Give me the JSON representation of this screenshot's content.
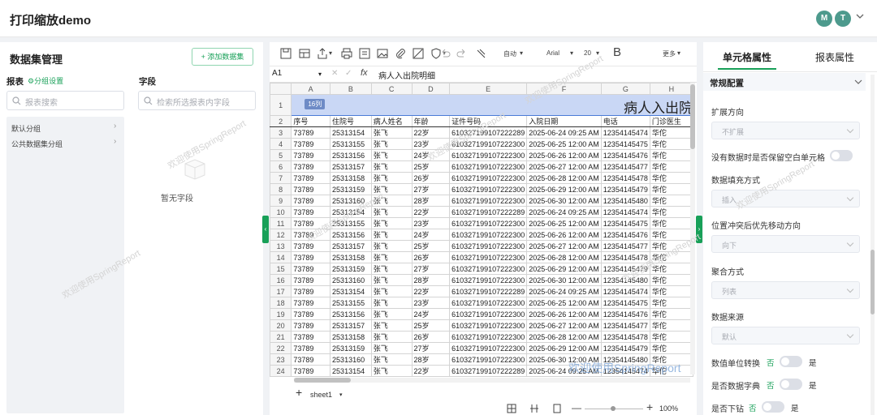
{
  "app": {
    "title": "打印缩放demo",
    "avatars": [
      "M",
      "T"
    ]
  },
  "left": {
    "title": "数据集管理",
    "add_button": "+ 添加数据集",
    "table_label": "报表",
    "group_settings": "分组设置",
    "table_search_placeholder": "报表搜索",
    "field_label": "字段",
    "field_search_placeholder": "检索所选报表内字段",
    "groups": [
      "默认分组",
      "公共数据集分组"
    ],
    "empty_text": "暂无字段"
  },
  "toolbar": {
    "auto": "自动",
    "font": "Arial",
    "font_size": "20",
    "more": "更多"
  },
  "formula": {
    "cell": "A1",
    "fx": "fx",
    "value": "病人入出院明细"
  },
  "sheet": {
    "columns": [
      "A",
      "B",
      "C",
      "D",
      "E",
      "F",
      "G",
      "H"
    ],
    "title_badge": "16列",
    "title_text": "病人入出院",
    "headers": [
      "序号",
      "住院号",
      "病人姓名",
      "年龄",
      "证件号码",
      "入院日期",
      "电话",
      "门诊医生"
    ],
    "rows": [
      [
        "3",
        "73789",
        "25313154",
        "张飞",
        "22岁",
        "610327199107222289",
        "2025-06-24 09:25 AM",
        "12354145474",
        "华佗"
      ],
      [
        "4",
        "73789",
        "25313155",
        "张飞",
        "23岁",
        "610327199107222300",
        "2025-06-25 12:00 AM",
        "12354145475",
        "华佗"
      ],
      [
        "5",
        "73789",
        "25313156",
        "张飞",
        "24岁",
        "610327199107222300",
        "2025-06-26 12:00 AM",
        "12354145476",
        "华佗"
      ],
      [
        "6",
        "73789",
        "25313157",
        "张飞",
        "25岁",
        "610327199107222300",
        "2025-06-27 12:00 AM",
        "12354145477",
        "华佗"
      ],
      [
        "7",
        "73789",
        "25313158",
        "张飞",
        "26岁",
        "610327199107222300",
        "2025-06-28 12:00 AM",
        "12354145478",
        "华佗"
      ],
      [
        "8",
        "73789",
        "25313159",
        "张飞",
        "27岁",
        "610327199107222300",
        "2025-06-29 12:00 AM",
        "12354145479",
        "华佗"
      ],
      [
        "9",
        "73789",
        "25313160",
        "张飞",
        "28岁",
        "610327199107222300",
        "2025-06-30 12:00 AM",
        "12354145480",
        "华佗"
      ],
      [
        "10",
        "73789",
        "25313154",
        "张飞",
        "22岁",
        "610327199107222289",
        "2025-06-24 09:25 AM",
        "12354145474",
        "华佗"
      ],
      [
        "11",
        "73789",
        "25313155",
        "张飞",
        "23岁",
        "610327199107222300",
        "2025-06-25 12:00 AM",
        "12354145475",
        "华佗"
      ],
      [
        "12",
        "73789",
        "25313156",
        "张飞",
        "24岁",
        "610327199107222300",
        "2025-06-26 12:00 AM",
        "12354145476",
        "华佗"
      ],
      [
        "13",
        "73789",
        "25313157",
        "张飞",
        "25岁",
        "610327199107222300",
        "2025-06-27 12:00 AM",
        "12354145477",
        "华佗"
      ],
      [
        "14",
        "73789",
        "25313158",
        "张飞",
        "26岁",
        "610327199107222300",
        "2025-06-28 12:00 AM",
        "12354145478",
        "华佗"
      ],
      [
        "15",
        "73789",
        "25313159",
        "张飞",
        "27岁",
        "610327199107222300",
        "2025-06-29 12:00 AM",
        "12354145479",
        "华佗"
      ],
      [
        "16",
        "73789",
        "25313160",
        "张飞",
        "28岁",
        "610327199107222300",
        "2025-06-30 12:00 AM",
        "12354145480",
        "华佗"
      ],
      [
        "17",
        "73789",
        "25313154",
        "张飞",
        "22岁",
        "610327199107222289",
        "2025-06-24 09:25 AM",
        "12354145474",
        "华佗"
      ],
      [
        "18",
        "73789",
        "25313155",
        "张飞",
        "23岁",
        "610327199107222300",
        "2025-06-25 12:00 AM",
        "12354145475",
        "华佗"
      ],
      [
        "19",
        "73789",
        "25313156",
        "张飞",
        "24岁",
        "610327199107222300",
        "2025-06-26 12:00 AM",
        "12354145476",
        "华佗"
      ],
      [
        "20",
        "73789",
        "25313157",
        "张飞",
        "25岁",
        "610327199107222300",
        "2025-06-27 12:00 AM",
        "12354145477",
        "华佗"
      ],
      [
        "21",
        "73789",
        "25313158",
        "张飞",
        "26岁",
        "610327199107222300",
        "2025-06-28 12:00 AM",
        "12354145478",
        "华佗"
      ],
      [
        "22",
        "73789",
        "25313159",
        "张飞",
        "27岁",
        "610327199107222300",
        "2025-06-29 12:00 AM",
        "12354145479",
        "华佗"
      ],
      [
        "23",
        "73789",
        "25313160",
        "张飞",
        "28岁",
        "610327199107222300",
        "2025-06-30 12:00 AM",
        "12354145480",
        "华佗"
      ],
      [
        "24",
        "73789",
        "25313154",
        "张飞",
        "22岁",
        "610327199107222289",
        "2025-06-24 09:25 AM",
        "12354145474",
        "华佗"
      ]
    ],
    "tab": "sheet1",
    "zoom": "100%"
  },
  "right": {
    "tab_cell": "单元格属性",
    "tab_report": "报表属性",
    "section": "常规配置",
    "expand_label": "扩展方向",
    "expand_value": "不扩展",
    "keep_blank_label": "没有数据时是否保留空白单元格",
    "fill_label": "数据填充方式",
    "fill_value": "插入",
    "conflict_label": "位置冲突后优先移动方向",
    "conflict_value": "向下",
    "agg_label": "聚合方式",
    "agg_value": "列表",
    "source_label": "数据来源",
    "source_value": "默认",
    "unit_label": "数值单位转换",
    "dict_label": "是否数据字典",
    "drill_label": "是否下钻",
    "no": "否",
    "yes": "是"
  },
  "watermark": "欢迎使用SpringReport",
  "colors": {
    "accent": "#18a058",
    "selection": "#c9d7f5",
    "avatar": "#4d9a8d"
  }
}
